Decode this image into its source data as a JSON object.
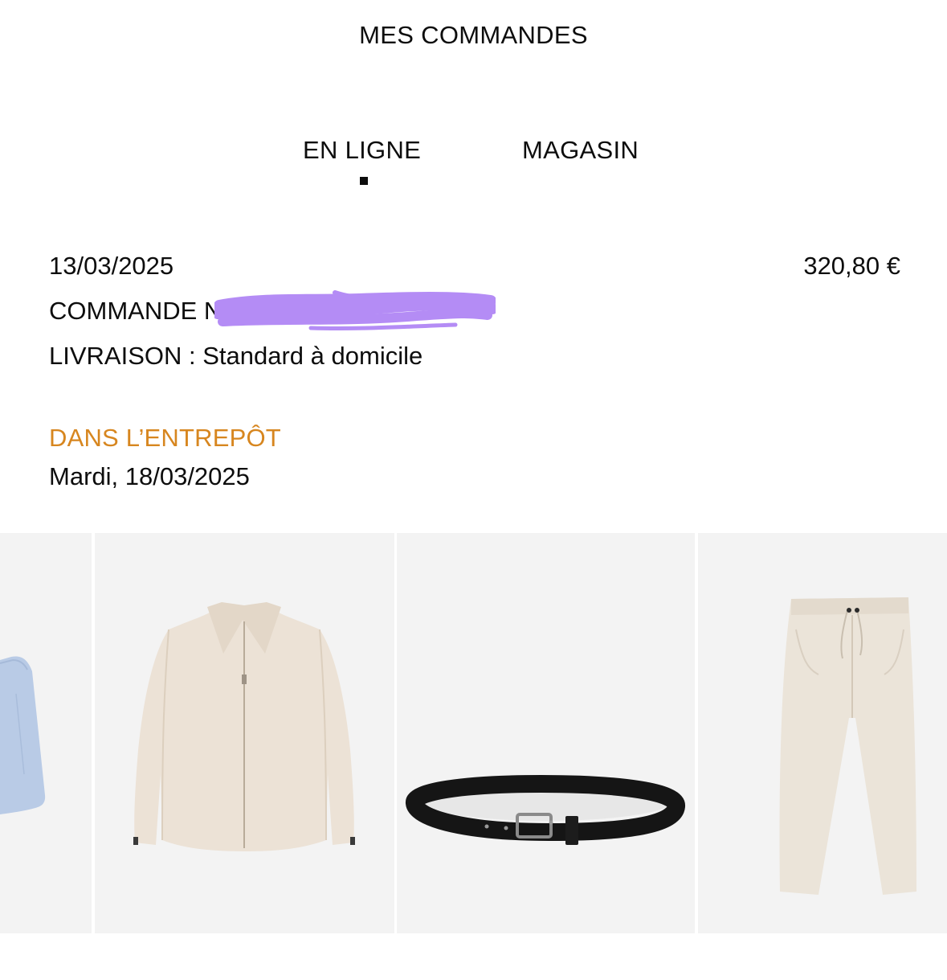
{
  "header": {
    "title": "MES COMMANDES"
  },
  "tabs": [
    {
      "label": "EN LIGNE",
      "active": true
    },
    {
      "label": "MAGASIN",
      "active": false
    }
  ],
  "order": {
    "date": "13/03/2025",
    "total": "320,80 €",
    "number_label": "COMMANDE N°",
    "delivery_label": "LIVRAISON :",
    "delivery_value": "Standard à domicile",
    "redaction_color": "#b48cf5"
  },
  "status": {
    "label": "DANS L’ENTREPÔT",
    "date": "Mardi, 18/03/2025",
    "color": "#d7861f"
  },
  "products": [
    {
      "item": "blue-shorts"
    },
    {
      "item": "beige-zip-jacket"
    },
    {
      "item": "black-leather-belt"
    },
    {
      "item": "beige-drawstring-trousers"
    }
  ]
}
